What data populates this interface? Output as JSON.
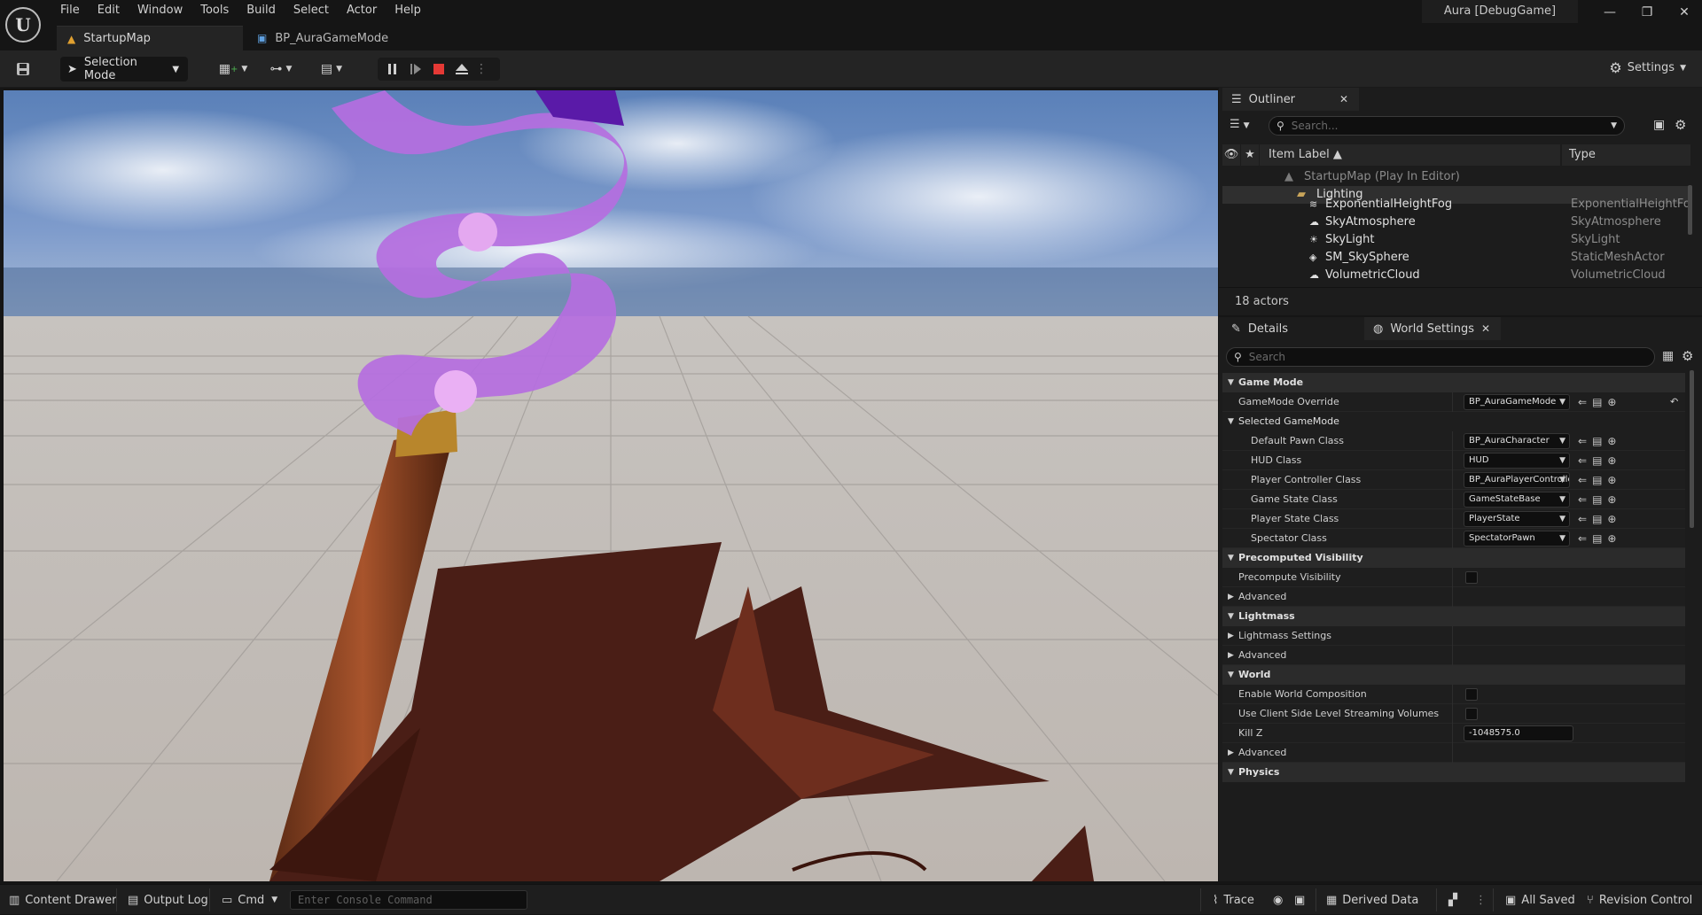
{
  "menu": [
    "File",
    "Edit",
    "Window",
    "Tools",
    "Build",
    "Select",
    "Actor",
    "Help"
  ],
  "project_name": "Aura [DebugGame]",
  "tabs": [
    {
      "label": "StartupMap",
      "icon": "level-icon"
    },
    {
      "label": "BP_AuraGameMode",
      "icon": "blueprint-icon"
    }
  ],
  "toolbar": {
    "mode": "Selection Mode",
    "settings": "Settings"
  },
  "outliner": {
    "tab": "Outliner",
    "search_placeholder": "Search...",
    "col_label": "Item Label ▲",
    "col_type": "Type",
    "root": "StartupMap (Play In Editor)",
    "folder": "Lighting",
    "items": [
      {
        "label": "ExponentialHeightFog",
        "type": "ExponentialHeightFog"
      },
      {
        "label": "SkyAtmosphere",
        "type": "SkyAtmosphere"
      },
      {
        "label": "SkyLight",
        "type": "SkyLight"
      },
      {
        "label": "SM_SkySphere",
        "type": "StaticMeshActor"
      },
      {
        "label": "VolumetricCloud",
        "type": "VolumetricCloud"
      }
    ],
    "actor_count": "18 actors"
  },
  "details": {
    "tab_details": "Details",
    "tab_world": "World Settings",
    "search_placeholder": "Search",
    "game_mode": {
      "category": "Game Mode",
      "override_label": "GameMode Override",
      "override_value": "BP_AuraGameMode",
      "selected": "Selected GameMode",
      "default_pawn_label": "Default Pawn Class",
      "default_pawn_value": "BP_AuraCharacter",
      "hud_label": "HUD Class",
      "hud_value": "HUD",
      "pc_label": "Player Controller Class",
      "pc_value": "BP_AuraPlayerController",
      "gs_label": "Game State Class",
      "gs_value": "GameStateBase",
      "ps_label": "Player State Class",
      "ps_value": "PlayerState",
      "spec_label": "Spectator Class",
      "spec_value": "SpectatorPawn"
    },
    "precomputed": {
      "category": "Precomputed Visibility",
      "precompute_label": "Precompute Visibility",
      "advanced": "Advanced"
    },
    "lightmass": {
      "category": "Lightmass",
      "settings": "Lightmass Settings",
      "advanced": "Advanced"
    },
    "world": {
      "category": "World",
      "composition_label": "Enable World Composition",
      "streaming_label": "Use Client Side Level Streaming Volumes",
      "killz_label": "Kill Z",
      "killz_value": "-1048575.0",
      "advanced": "Advanced"
    },
    "physics": {
      "category": "Physics"
    }
  },
  "statusbar": {
    "content_drawer": "Content Drawer",
    "output_log": "Output Log",
    "cmd": "Cmd",
    "console_placeholder": "Enter Console Command",
    "trace": "Trace",
    "derived_data": "Derived Data",
    "all_saved": "All Saved",
    "revision_control": "Revision Control"
  }
}
